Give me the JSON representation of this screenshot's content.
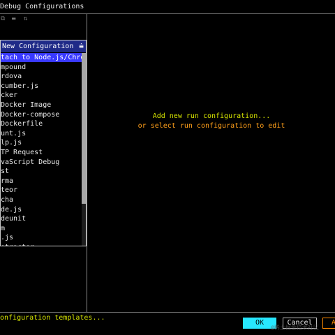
{
  "window": {
    "title": "Debug Configurations"
  },
  "toolbar": {
    "icons": [
      "copy-icon",
      "move-icon",
      "sort-icon"
    ]
  },
  "popup": {
    "header_label": "New Configuration",
    "header_icon": "filter-icon",
    "items": [
      "tach to Node.js/Chrome",
      "mpound",
      "rdova",
      "cumber.js",
      "cker",
      " Docker Image",
      " Docker-compose",
      " Dockerfile",
      "unt.js",
      "lp.js",
      "TP Request",
      "vaScript Debug",
      "st",
      "rma",
      "teor",
      "cha",
      "de.js",
      "deunit",
      "m",
      ".js",
      "otractor"
    ],
    "selected_index": 0
  },
  "left": {
    "templates_link": "onfiguration templates..."
  },
  "main": {
    "hint_line1": "Add new run configuration...",
    "hint_line2": "or select run configuration to edit"
  },
  "footer": {
    "ok_label": "OK",
    "cancel_label": "Cancel",
    "apply_label": "A"
  },
  "watermark": "@稀土掘金技术社区",
  "colors": {
    "selection": "#3939ff",
    "header": "#1f2a88",
    "hint_yellow": "#d6e400",
    "hint_orange": "#ff9f1a",
    "ok_button": "#27e7ff",
    "apply_button": "#ff8a00"
  }
}
